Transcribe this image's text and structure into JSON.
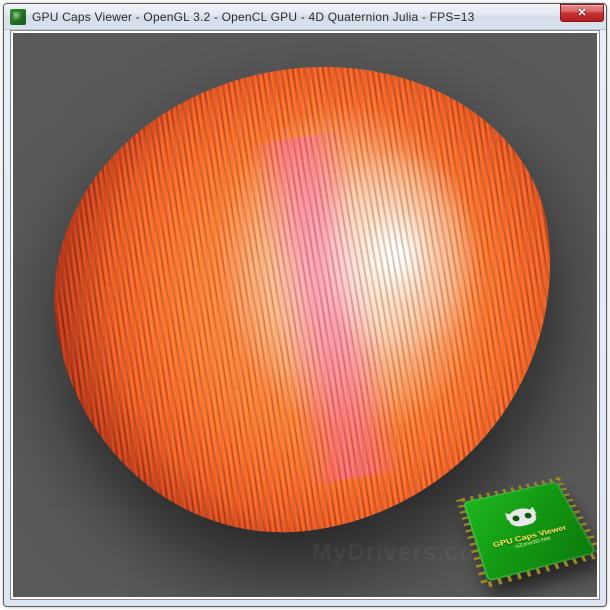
{
  "window": {
    "title": "GPU Caps Viewer - OpenGL 3.2 - OpenCL GPU - 4D Quaternion Julia - FPS=13"
  },
  "badge": {
    "title": "GPU Caps Viewer",
    "subtitle": "oZone3D.Net"
  },
  "watermark": "MyDrivers.com"
}
